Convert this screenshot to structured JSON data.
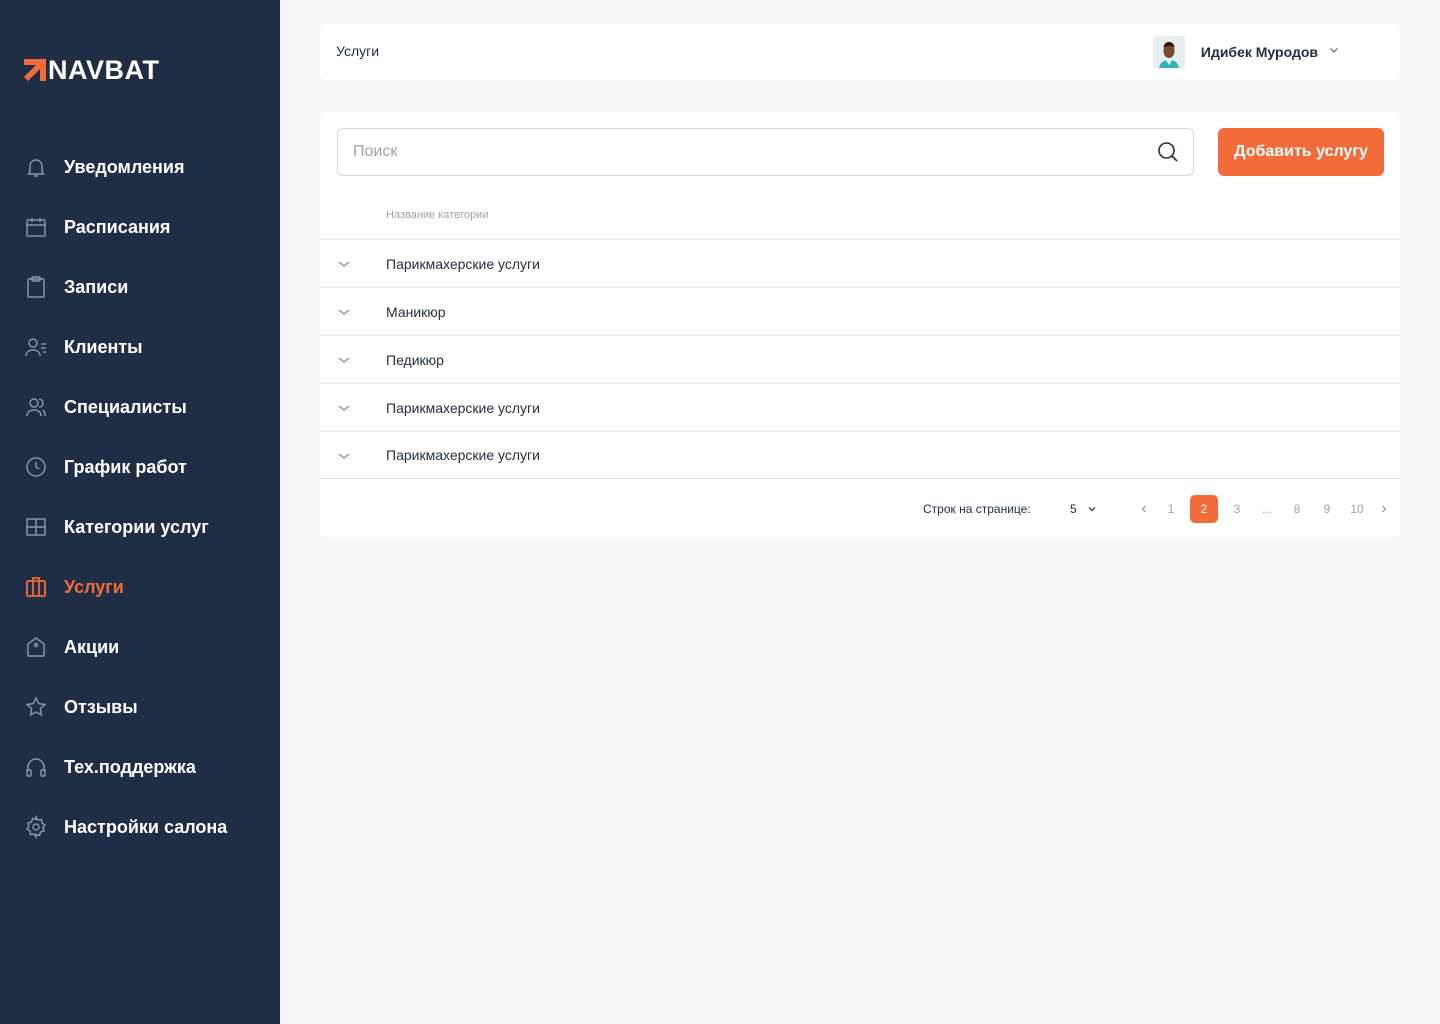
{
  "brand": {
    "name": "NAVBAT",
    "accent": "#f26b3a",
    "sidebar_bg": "#1f2d45"
  },
  "sidebar": {
    "items": [
      {
        "label": "Уведомления",
        "icon": "bell-icon",
        "active": false
      },
      {
        "label": "Расписания",
        "icon": "calendar-icon",
        "active": false
      },
      {
        "label": "Записи",
        "icon": "clipboard-icon",
        "active": false
      },
      {
        "label": "Клиенты",
        "icon": "user-list-icon",
        "active": false
      },
      {
        "label": "Специалисты",
        "icon": "users-icon",
        "active": false
      },
      {
        "label": "График работ",
        "icon": "clock-icon",
        "active": false
      },
      {
        "label": "Категории услуг",
        "icon": "grid-icon",
        "active": false
      },
      {
        "label": "Услуги",
        "icon": "briefcase-icon",
        "active": true
      },
      {
        "label": "Акции",
        "icon": "tag-icon",
        "active": false
      },
      {
        "label": "Отзывы",
        "icon": "star-icon",
        "active": false
      },
      {
        "label": "Тех.поддержка",
        "icon": "headphones-icon",
        "active": false
      },
      {
        "label": "Настройки салона",
        "icon": "gear-icon",
        "active": false
      }
    ]
  },
  "header": {
    "title": "Услуги",
    "user_name": "Идибек Муродов"
  },
  "toolbar": {
    "search_placeholder": "Поиск",
    "add_label": "Добавить услугу"
  },
  "table": {
    "column_header": "Название категории",
    "rows": [
      "Парикмахерские услуги",
      "Маникюр",
      "Педикюр",
      "Парикмахерские услуги",
      "Парикмахерские услуги"
    ]
  },
  "pagination": {
    "rows_label": "Строк на странице:",
    "rows_value": "5",
    "pages": [
      "1",
      "2",
      "3",
      "...",
      "8",
      "9",
      "10"
    ],
    "current": "2"
  }
}
